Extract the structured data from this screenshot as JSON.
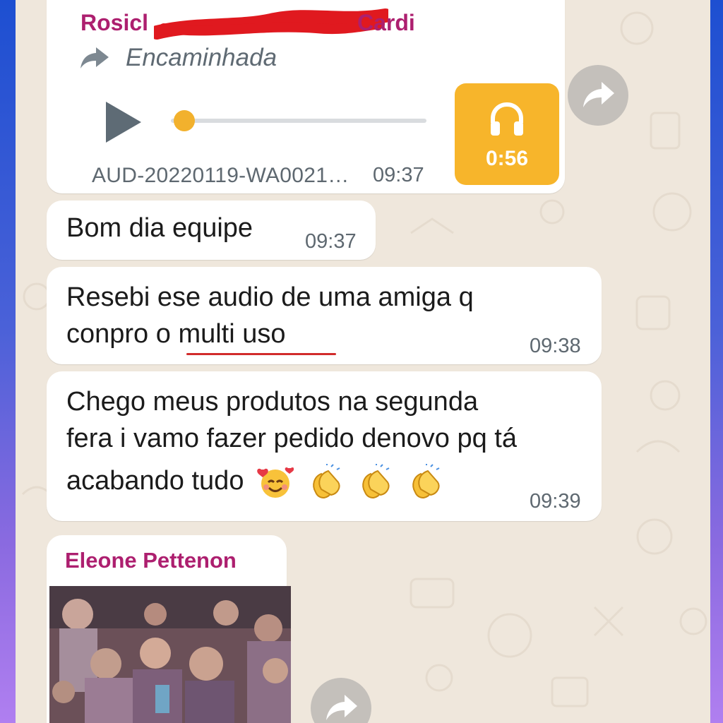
{
  "messages": {
    "audio": {
      "sender": "Rosicl",
      "sender_tail": "Cardi",
      "forwarded_label": "Encaminhada",
      "file_name": "AUD-20220119-WA0021…",
      "time": "09:37",
      "duration": "0:56",
      "progress": 0.0
    },
    "m1": {
      "text": "Bom dia equipe",
      "time": "09:37"
    },
    "m2": {
      "line1": "Resebi ese audio de uma amiga q",
      "line2": "conpro o multi uso",
      "time": "09:38"
    },
    "m3": {
      "line1": "Chego meus produtos na segunda",
      "line2": "fera i vamo fazer pedido denovo pq tá",
      "line3": "acabando tudo",
      "time": "09:39"
    },
    "media": {
      "sender": "Eleone Pettenon"
    }
  },
  "icons": {
    "forwarded": "forward-arrow-icon",
    "play": "play-icon",
    "audio_thumb": "headphones-icon",
    "forward_button": "share-forward-icon",
    "emoji_1": "smiling-face-with-hearts-icon",
    "emoji_2": "clapping-hands-icon"
  },
  "colors": {
    "sender": "#ad1f6f",
    "accent_audio": "#f7b52b",
    "chat_background": "#efe7dc",
    "frame_gradient_top": "#1d4fd1",
    "frame_gradient_bottom": "#b07ff0"
  }
}
